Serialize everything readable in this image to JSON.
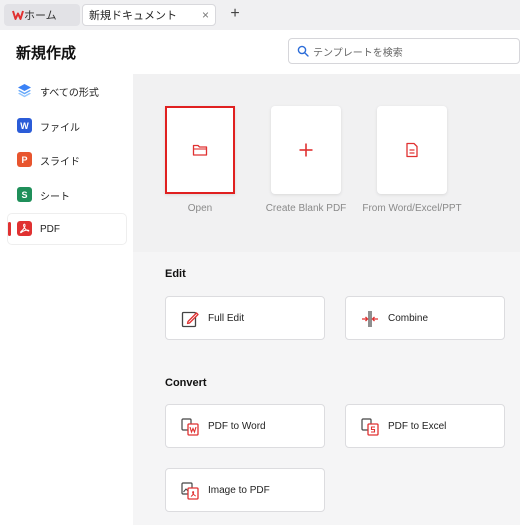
{
  "tabs": {
    "home_label": "ホーム",
    "doc_label": "新規ドキュメント",
    "close_glyph": "×",
    "add_glyph": "+"
  },
  "header": {
    "title": "新規作成",
    "search_placeholder": "テンプレートを検索"
  },
  "sidebar": {
    "items": [
      {
        "label": "すべての形式",
        "icon": "layers-icon",
        "color": "#3b82f6"
      },
      {
        "label": "ファイル",
        "icon": "word-icon",
        "letter": "W",
        "color": "#2b5cd8"
      },
      {
        "label": "スライド",
        "icon": "slides-icon",
        "letter": "P",
        "color": "#e8552e"
      },
      {
        "label": "シート",
        "icon": "sheets-icon",
        "letter": "S",
        "color": "#1f8f5a"
      },
      {
        "label": "PDF",
        "icon": "pdf-icon",
        "color": "#e03131",
        "active": true
      }
    ]
  },
  "quick_actions": [
    {
      "label": "Open",
      "icon": "folder-icon",
      "selected": true
    },
    {
      "label": "Create Blank PDF",
      "icon": "plus-icon"
    },
    {
      "label": "From Word/Excel/PPT",
      "icon": "document-icon"
    }
  ],
  "edit": {
    "heading": "Edit",
    "items": [
      {
        "label": "Full Edit",
        "icon": "edit-icon"
      },
      {
        "label": "Combine",
        "icon": "combine-icon"
      }
    ]
  },
  "convert": {
    "heading": "Convert",
    "items": [
      {
        "label": "PDF to Word",
        "icon": "pdf-to-word-icon"
      },
      {
        "label": "PDF to Excel",
        "icon": "pdf-to-excel-icon"
      },
      {
        "label": "Image to PDF",
        "icon": "image-to-pdf-icon"
      }
    ]
  },
  "colors": {
    "accent": "#e03131",
    "sidebar_active_bar": "#e03131"
  }
}
